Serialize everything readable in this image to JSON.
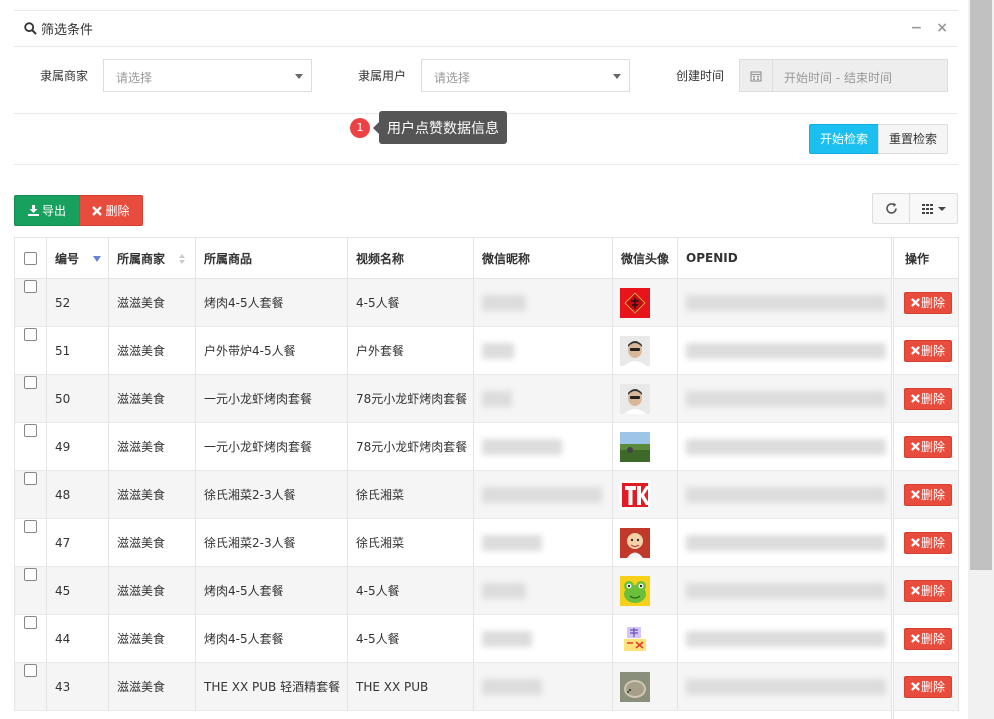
{
  "filter": {
    "title": "筛选条件",
    "minimize_symbol": "−",
    "close_symbol": "×",
    "merchant_label": "隶属商家",
    "merchant_placeholder": "请选择",
    "user_label": "隶属用户",
    "user_placeholder": "请选择",
    "created_label": "创建时间",
    "date_placeholder": "开始时间 - 结束时间",
    "search_button": "开始检索",
    "reset_button": "重置检索"
  },
  "tooltip": {
    "badge": "1",
    "text": "用户点赞数据信息"
  },
  "toolbar": {
    "export_label": "导出",
    "delete_label": "删除"
  },
  "table": {
    "headers": [
      "编号",
      "所属商家",
      "所属商品",
      "视频名称",
      "微信昵称",
      "微信头像",
      "OPENID",
      "操作"
    ],
    "row_delete_label": "删除",
    "rows": [
      {
        "id": "52",
        "merchant": "滋滋美食",
        "product": "烤肉4-5人套餐",
        "video": "4-5人餐",
        "avatar": "fu"
      },
      {
        "id": "51",
        "merchant": "滋滋美食",
        "product": "户外带炉4-5人餐",
        "video": "户外套餐",
        "avatar": "man"
      },
      {
        "id": "50",
        "merchant": "滋滋美食",
        "product": "一元小龙虾烤肉套餐",
        "video": "78元小龙虾烤肉套餐",
        "avatar": "man"
      },
      {
        "id": "49",
        "merchant": "滋滋美食",
        "product": "一元小龙虾烤肉套餐",
        "video": "78元小龙虾烤肉套餐",
        "avatar": "field"
      },
      {
        "id": "48",
        "merchant": "滋滋美食",
        "product": "徐氏湘菜2-3人餐",
        "video": "徐氏湘菜",
        "avatar": "tk"
      },
      {
        "id": "47",
        "merchant": "滋滋美食",
        "product": "徐氏湘菜2-3人餐",
        "video": "徐氏湘菜",
        "avatar": "cartoon"
      },
      {
        "id": "45",
        "merchant": "滋滋美食",
        "product": "烤肉4-5人套餐",
        "video": "4-5人餐",
        "avatar": "frog"
      },
      {
        "id": "44",
        "merchant": "滋滋美食",
        "product": "烤肉4-5人套餐",
        "video": "4-5人餐",
        "avatar": "text"
      },
      {
        "id": "43",
        "merchant": "滋滋美食",
        "product": "THE XX PUB 轻酒精套餐",
        "video": "THE XX PUB",
        "avatar": "hedgehog"
      }
    ]
  },
  "colors": {
    "primary": "#1cc0f0",
    "success": "#18a05e",
    "danger": "#e74c3c"
  }
}
